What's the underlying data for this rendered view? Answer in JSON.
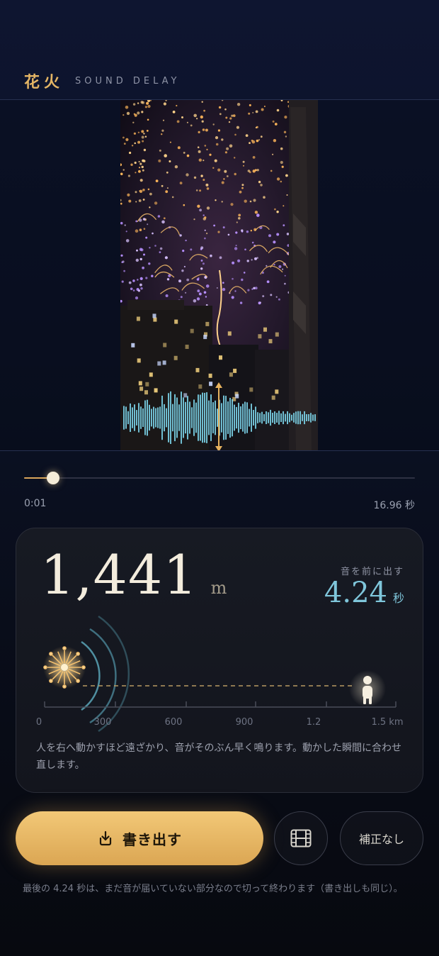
{
  "header": {
    "brand_kanji": "花火",
    "brand_sub": "SOUND DELAY"
  },
  "video": {
    "content": "fireworks-night-city-frame",
    "waveform_color": "#7ad0e6",
    "marker_color": "#e6b25e"
  },
  "playback": {
    "current_time": "0:01",
    "duration": "16.96 秒",
    "progress": 0.07
  },
  "distance_card": {
    "distance_value": "1,441",
    "distance_unit": "m",
    "advance_label": "音を前に出す",
    "advance_value": "4.24",
    "advance_unit": "秒",
    "scale_ticks": [
      "0",
      "300",
      "600",
      "900",
      "1.2",
      "1.5 km"
    ],
    "person_position_m": 1441,
    "scale_max_m": 1500,
    "note": "人を右へ動かすほど遠ざかり、音がそのぶん早く鳴ります。動かした瞬間に合わせ直します。",
    "icons": [
      "firework-burst-icon",
      "sound-wave-icon",
      "person-icon"
    ]
  },
  "actions": {
    "export_label": "書き出す",
    "export_icon": "download-tray-icon",
    "film_icon": "film-icon",
    "no_correction_label": "補正なし"
  },
  "footer": {
    "note": "最後の 4.24 秒は、まだ音が届いていない部分なので切って終わります（書き出しも同じ）。"
  },
  "colors": {
    "accent_gold": "#e4b565",
    "accent_cyan": "#7fc6db",
    "background": "#0b1226"
  }
}
